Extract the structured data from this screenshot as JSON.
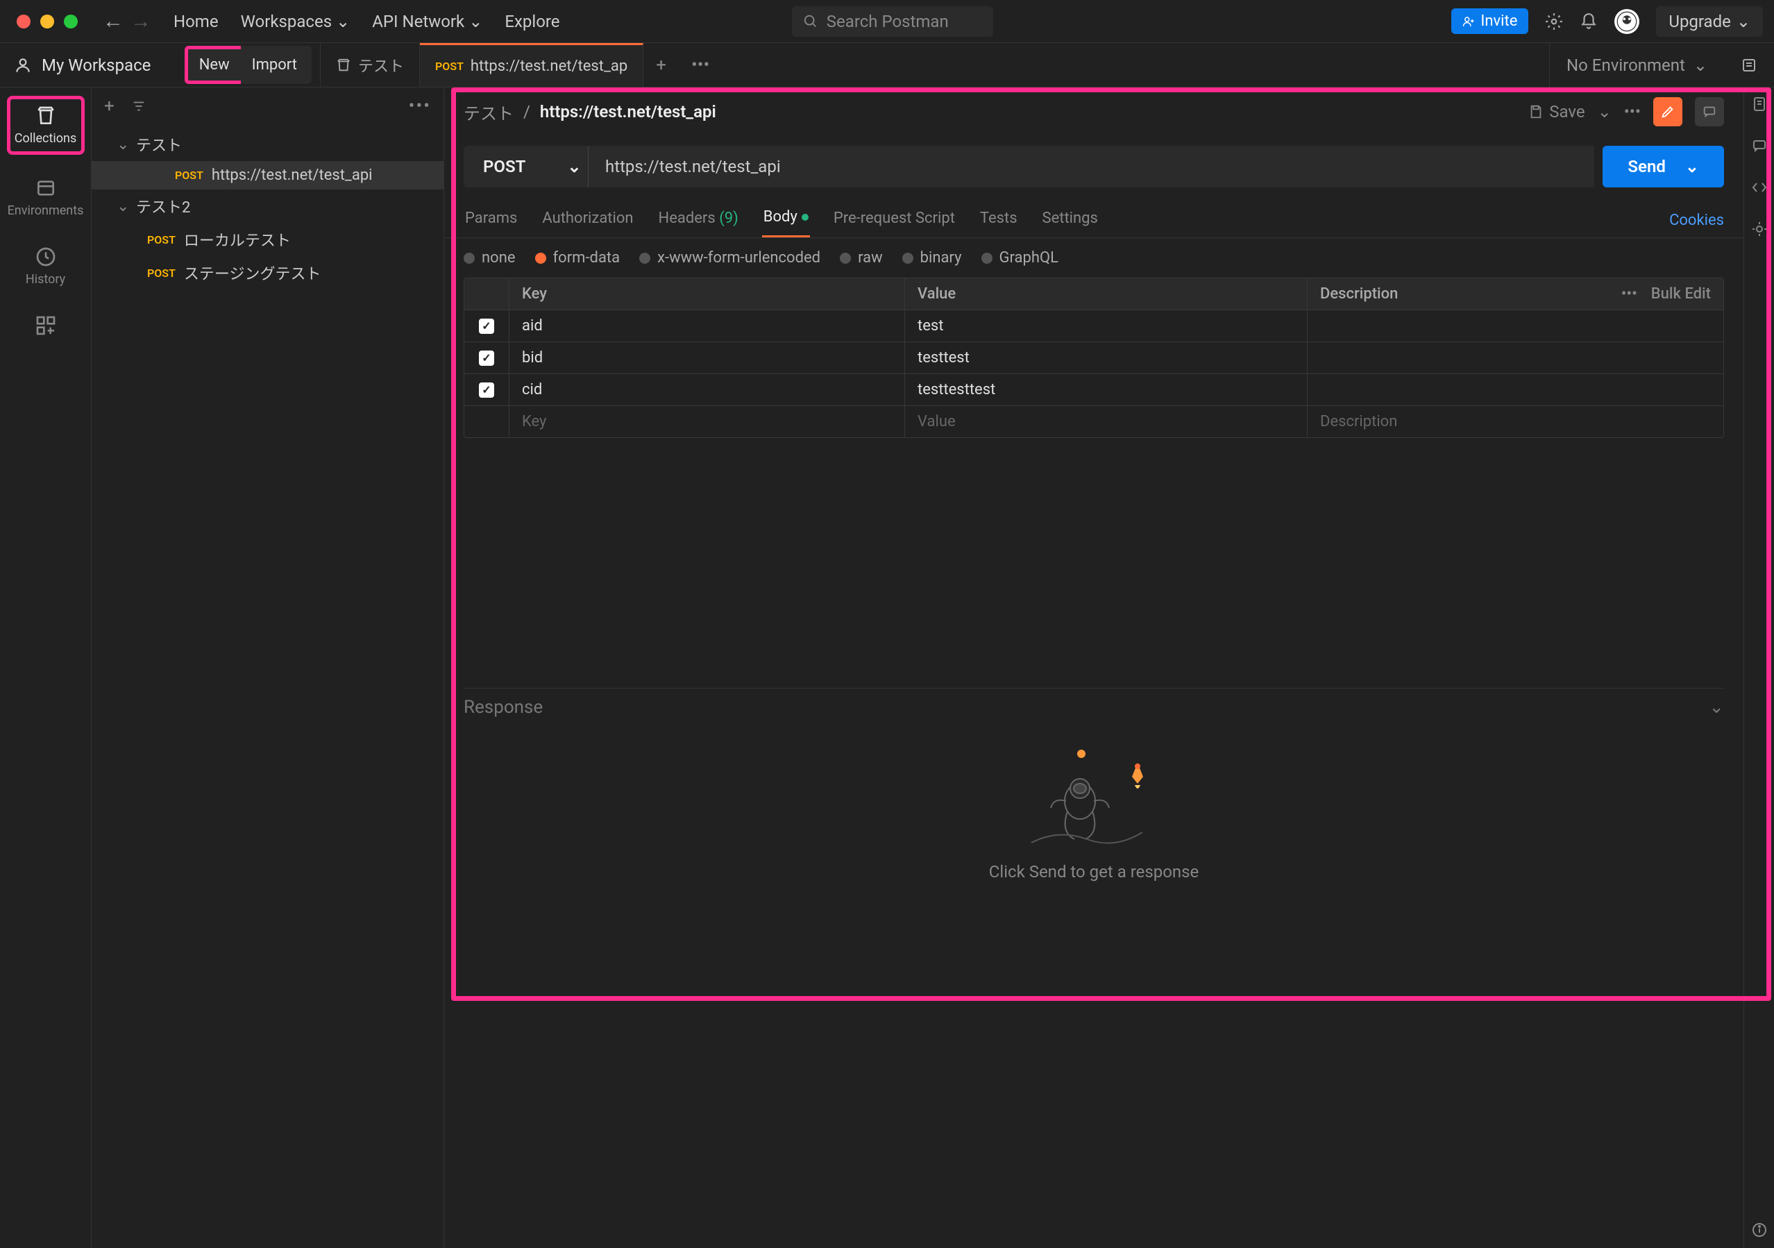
{
  "topbar": {
    "home": "Home",
    "workspaces": "Workspaces",
    "api_network": "API Network",
    "explore": "Explore",
    "search_placeholder": "Search Postman",
    "invite": "Invite",
    "upgrade": "Upgrade"
  },
  "workspace": {
    "name": "My Workspace",
    "new_btn": "New",
    "import_btn": "Import"
  },
  "tabs": [
    {
      "icon": "folder",
      "label": "テスト",
      "active": false
    },
    {
      "method": "POST",
      "label": "https://test.net/test_ap",
      "active": true
    }
  ],
  "env": {
    "label": "No Environment"
  },
  "rail": [
    {
      "label": "Collections",
      "active": true
    },
    {
      "label": "Environments",
      "active": false
    },
    {
      "label": "History",
      "active": false
    }
  ],
  "tree": {
    "c1": {
      "name": "テスト",
      "items": [
        {
          "method": "POST",
          "name": "https://test.net/test_api",
          "selected": true
        }
      ]
    },
    "c2": {
      "name": "テスト2",
      "items": [
        {
          "method": "POST",
          "name": "ローカルテスト"
        },
        {
          "method": "POST",
          "name": "ステージングテスト"
        }
      ]
    }
  },
  "breadcrumb": {
    "parent": "テスト",
    "sep": "/",
    "current": "https://test.net/test_api",
    "save": "Save"
  },
  "request": {
    "method": "POST",
    "url": "https://test.net/test_api",
    "send": "Send"
  },
  "reqtabs": {
    "params": "Params",
    "auth": "Authorization",
    "headers": "Headers",
    "headers_count": "(9)",
    "body": "Body",
    "prescript": "Pre-request Script",
    "tests": "Tests",
    "settings": "Settings",
    "cookies": "Cookies"
  },
  "bodytypes": {
    "none": "none",
    "formdata": "form-data",
    "xwww": "x-www-form-urlencoded",
    "raw": "raw",
    "binary": "binary",
    "graphql": "GraphQL"
  },
  "kv": {
    "head": {
      "key": "Key",
      "value": "Value",
      "desc": "Description",
      "bulk": "Bulk Edit"
    },
    "rows": [
      {
        "k": "aid",
        "v": "test"
      },
      {
        "k": "bid",
        "v": "testtest"
      },
      {
        "k": "cid",
        "v": "testtesttest"
      }
    ],
    "ph": {
      "key": "Key",
      "value": "Value",
      "desc": "Description"
    }
  },
  "response": {
    "label": "Response",
    "empty": "Click Send to get a response"
  }
}
